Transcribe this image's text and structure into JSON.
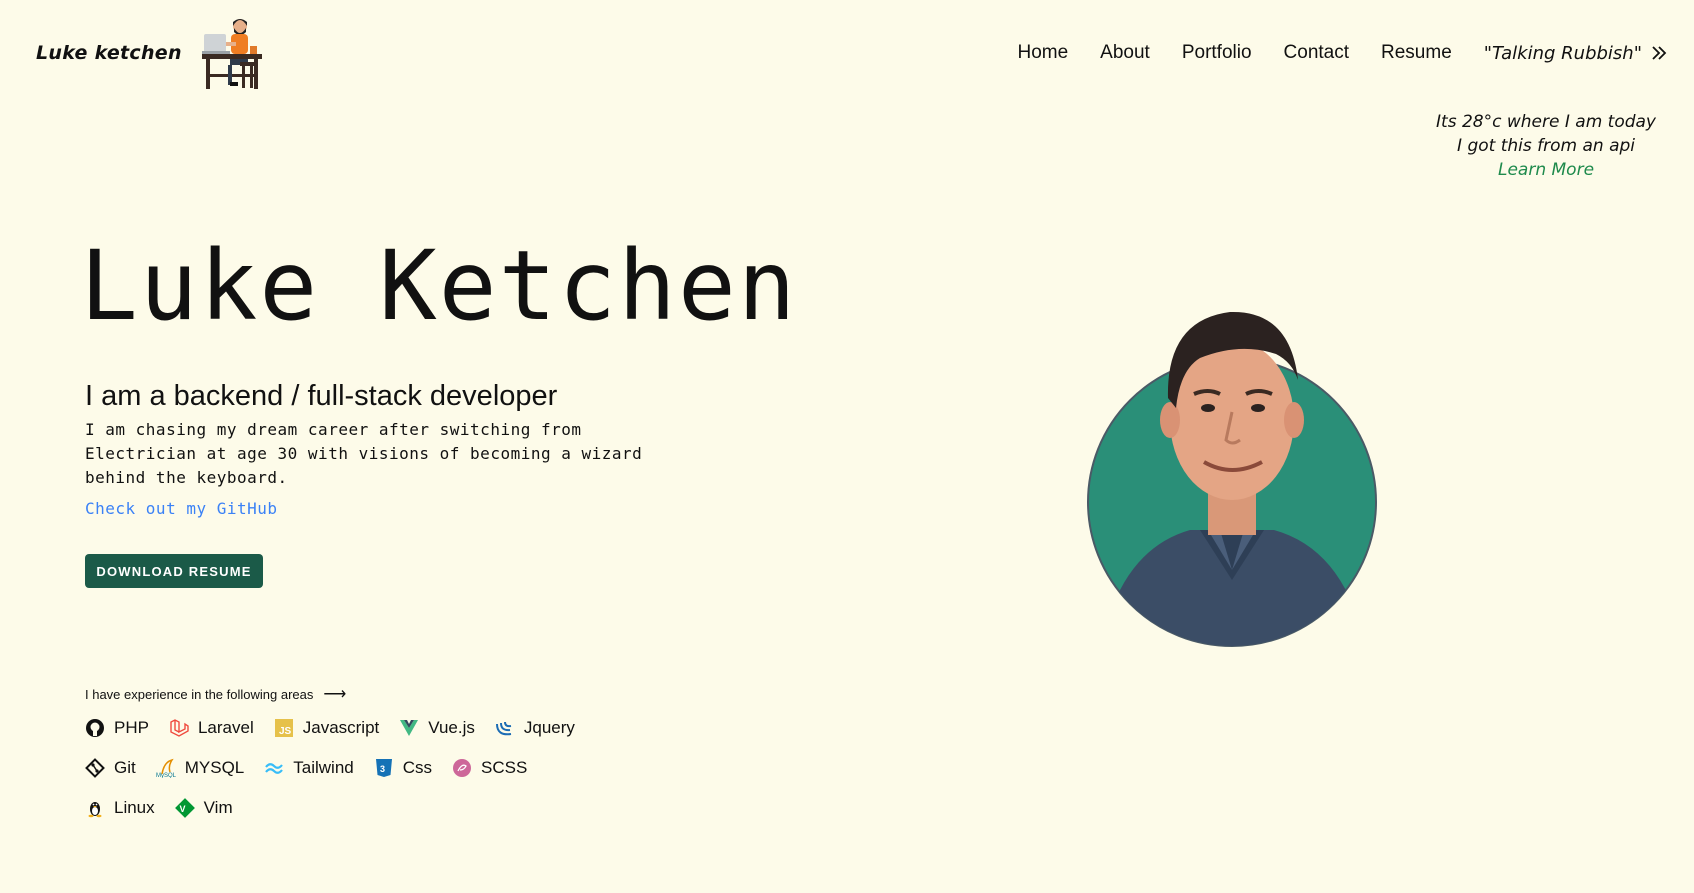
{
  "header": {
    "logo_text": "Luke ketchen",
    "nav": [
      {
        "label": "Home"
      },
      {
        "label": "About"
      },
      {
        "label": "Portfolio"
      },
      {
        "label": "Contact"
      },
      {
        "label": "Resume"
      },
      {
        "label": "\"Talking Rubbish\""
      }
    ]
  },
  "weather": {
    "line1": "Its 28°c where I am today",
    "line2": "I got this from an api",
    "link": "Learn More"
  },
  "hero": {
    "name": "Luke Ketchen",
    "subtitle": "I am a backend / full-stack developer",
    "description": "I am chasing my dream career after switching from Electrician at age 30 with visions of becoming a wizard behind the keyboard.",
    "github_link": "Check out my GitHub",
    "download_button": "DOWNLOAD RESUME"
  },
  "skills": {
    "label": "I have experience in the following areas",
    "arrow": "⟶",
    "items": [
      {
        "label": "PHP",
        "icon": "github-icon"
      },
      {
        "label": "Laravel",
        "icon": "laravel-icon"
      },
      {
        "label": "Javascript",
        "icon": "javascript-icon"
      },
      {
        "label": "Vue.js",
        "icon": "vue-icon"
      },
      {
        "label": "Jquery",
        "icon": "jquery-icon"
      },
      {
        "label": "Git",
        "icon": "git-icon"
      },
      {
        "label": "MYSQL",
        "icon": "mysql-icon"
      },
      {
        "label": "Tailwind",
        "icon": "tailwind-icon"
      },
      {
        "label": "Css",
        "icon": "css-icon"
      },
      {
        "label": "SCSS",
        "icon": "sass-icon"
      },
      {
        "label": "Linux",
        "icon": "linux-icon"
      },
      {
        "label": "Vim",
        "icon": "vim-icon"
      }
    ]
  },
  "colors": {
    "background": "#fdfbe9",
    "button": "#1b5a48",
    "link": "#3b82f6",
    "learn_more": "#1e8a4c",
    "portrait_circle": "#2a8f78"
  }
}
